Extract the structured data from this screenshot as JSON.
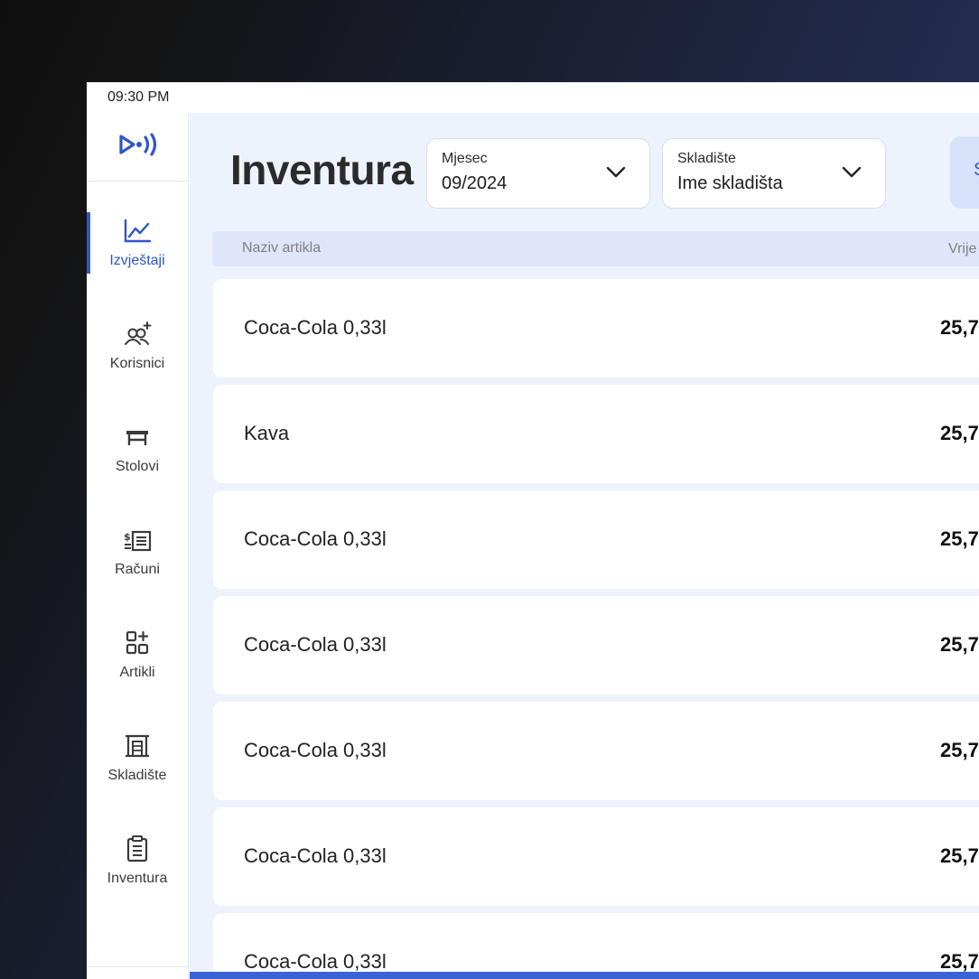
{
  "status_bar": {
    "time": "09:30 PM"
  },
  "app": {
    "logo_icon": "broadcast-logo-icon",
    "accent_color": "#2f56c9"
  },
  "sidebar": {
    "items": [
      {
        "label": "Izvještaji",
        "icon": "chart-line-icon",
        "active": true
      },
      {
        "label": "Korisnici",
        "icon": "users-add-icon",
        "active": false
      },
      {
        "label": "Stolovi",
        "icon": "table-icon",
        "active": false
      },
      {
        "label": "Računi",
        "icon": "receipt-icon",
        "active": false
      },
      {
        "label": "Artikli",
        "icon": "grid-add-icon",
        "active": false
      },
      {
        "label": "Skladište",
        "icon": "warehouse-icon",
        "active": false
      },
      {
        "label": "Inventura",
        "icon": "clipboard-icon",
        "active": false
      }
    ]
  },
  "header": {
    "title": "Inventura",
    "month_select": {
      "caption": "Mjesec",
      "value": "09/2024"
    },
    "warehouse_select": {
      "caption": "Skladište",
      "value": "Ime skladišta"
    },
    "action_button_label": "S"
  },
  "table": {
    "columns": [
      "Naziv artikla",
      "Vrije"
    ],
    "rows": [
      {
        "name": "Coca-Cola 0,33l",
        "value": "25,7"
      },
      {
        "name": "Kava",
        "value": "25,7"
      },
      {
        "name": "Coca-Cola 0,33l",
        "value": "25,7"
      },
      {
        "name": "Coca-Cola 0,33l",
        "value": "25,7"
      },
      {
        "name": "Coca-Cola 0,33l",
        "value": "25,7"
      },
      {
        "name": "Coca-Cola 0,33l",
        "value": "25,7"
      },
      {
        "name": "Coca-Cola 0,33l",
        "value": "25,7"
      }
    ]
  }
}
